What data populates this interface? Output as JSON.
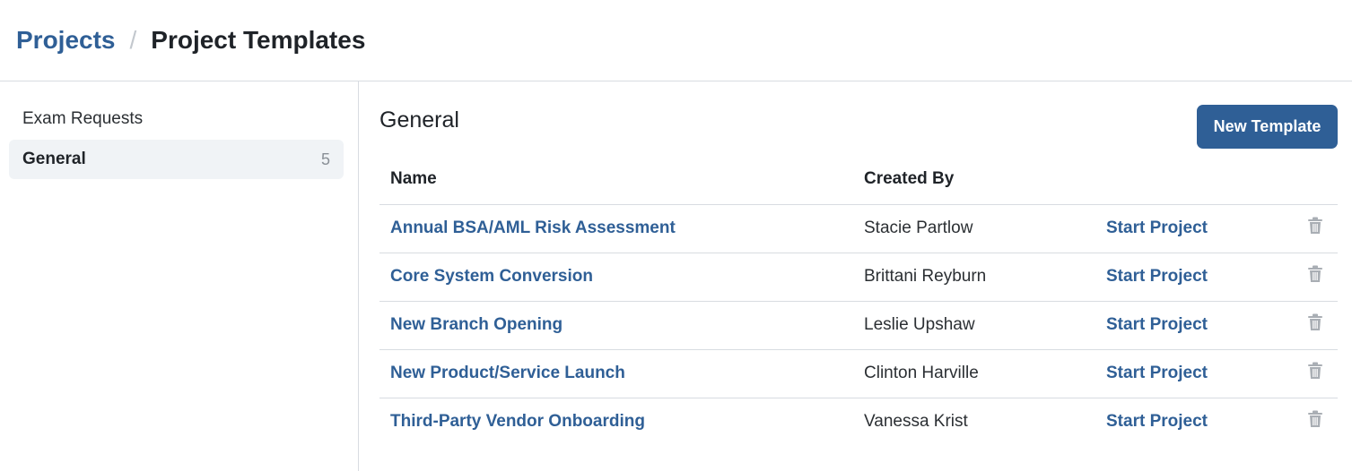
{
  "breadcrumb": {
    "parent": "Projects",
    "separator": "/",
    "current": "Project Templates"
  },
  "sidebar": {
    "items": [
      {
        "label": "Exam Requests",
        "count": ""
      },
      {
        "label": "General",
        "count": "5"
      }
    ]
  },
  "main": {
    "title": "General",
    "new_button_label": "New Template",
    "columns": {
      "name": "Name",
      "created_by": "Created By"
    },
    "rows": [
      {
        "name": "Annual BSA/AML Risk Assessment",
        "created_by": "Stacie Partlow",
        "action": "Start Project"
      },
      {
        "name": "Core System Conversion",
        "created_by": "Brittani Reyburn",
        "action": "Start Project"
      },
      {
        "name": "New Branch Opening",
        "created_by": "Leslie Upshaw",
        "action": "Start Project"
      },
      {
        "name": "New Product/Service Launch",
        "created_by": "Clinton Harville",
        "action": "Start Project"
      },
      {
        "name": "Third-Party Vendor Onboarding",
        "created_by": "Vanessa Krist",
        "action": "Start Project"
      }
    ],
    "row_delete_icon": "trash-icon"
  },
  "colors": {
    "accent": "#2f5f96",
    "border": "#d8dce1",
    "active_bg": "#f0f3f6",
    "icon_gray": "#a9aeb4"
  }
}
